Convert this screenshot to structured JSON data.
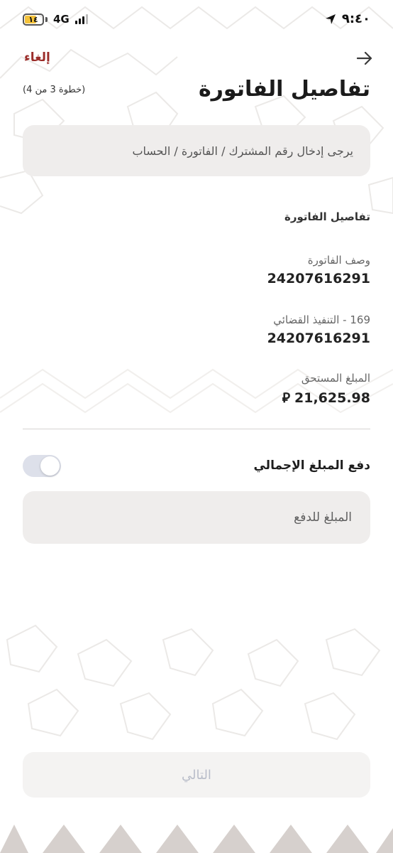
{
  "status_bar": {
    "battery": "١٤",
    "network": "4G",
    "time": "٩:٤٠"
  },
  "header": {
    "back_icon": "arrow-right-icon",
    "cancel_label": "إلغاء",
    "title": "تفاصيل الفاتورة",
    "step": "(خطوة 3 من 4)"
  },
  "info": {
    "text": "يرجى إدخال رقم المشترك / الفاتورة / الحساب"
  },
  "details": {
    "section_title": "تفاصيل الفاتورة",
    "fields": [
      {
        "label": "وصف الفاتورة",
        "value": "24207616291"
      },
      {
        "label": "169 - التنفيذ القضائي",
        "value": "24207616291"
      }
    ],
    "amount_label": "المبلغ المستحق",
    "amount_value": "21,625.98",
    "currency_symbol": "⃁"
  },
  "pay_total": {
    "label": "دفع المبلغ الإجمالي",
    "toggle_on": false
  },
  "amount_input": {
    "placeholder": "المبلغ للدفع",
    "value": ""
  },
  "footer": {
    "next_label": "التالي"
  },
  "colors": {
    "accent": "#9b2d2a",
    "field_bg": "#efedec",
    "disabled_text": "#b9bdc9"
  }
}
